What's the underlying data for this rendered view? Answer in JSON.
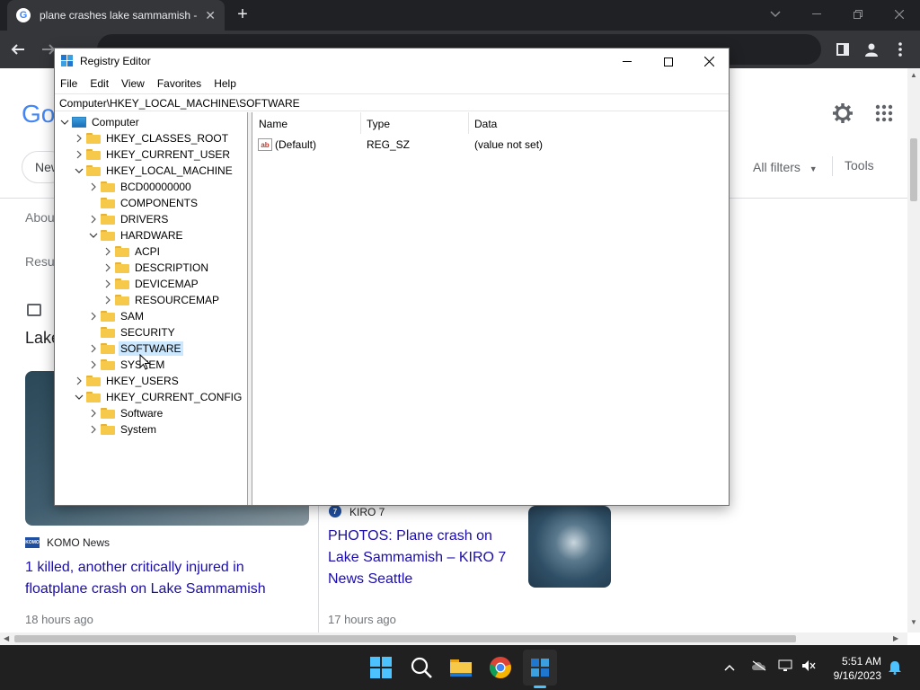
{
  "browser": {
    "tab_title": "plane crashes lake sammamish -",
    "tab_close": "✕",
    "new_tab": "+",
    "favicon": "G"
  },
  "google": {
    "logo_partial": "Go",
    "news_chip": "New",
    "all_filters": "All filters",
    "tools": "Tools",
    "about_partial": "Abou",
    "results_partial": "Resu",
    "lake_partial": "Lake",
    "article_1": {
      "source": "KOMO News",
      "source_logo": "KOMO",
      "headline": "1 killed, another critically injured in floatplane crash on Lake Sammamish",
      "time": "18 hours ago"
    },
    "article_2": {
      "source": "KIRO 7",
      "source_logo": "7",
      "headline": "PHOTOS: Plane crash on Lake Sammamish – KIRO 7 News Seattle",
      "time": "17 hours ago"
    }
  },
  "regedit": {
    "title": "Registry Editor",
    "menu": [
      "File",
      "Edit",
      "View",
      "Favorites",
      "Help"
    ],
    "address": "Computer\\HKEY_LOCAL_MACHINE\\SOFTWARE",
    "tree": [
      {
        "label": "Computer",
        "level": 0,
        "expander": "open",
        "icon": "computer"
      },
      {
        "label": "HKEY_CLASSES_ROOT",
        "level": 1,
        "expander": "closed",
        "icon": "folder"
      },
      {
        "label": "HKEY_CURRENT_USER",
        "level": 1,
        "expander": "closed",
        "icon": "folder"
      },
      {
        "label": "HKEY_LOCAL_MACHINE",
        "level": 1,
        "expander": "open",
        "icon": "folder"
      },
      {
        "label": "BCD00000000",
        "level": 2,
        "expander": "closed",
        "icon": "folder"
      },
      {
        "label": "COMPONENTS",
        "level": 2,
        "expander": "none",
        "icon": "folder"
      },
      {
        "label": "DRIVERS",
        "level": 2,
        "expander": "closed",
        "icon": "folder"
      },
      {
        "label": "HARDWARE",
        "level": 2,
        "expander": "open",
        "icon": "folder"
      },
      {
        "label": "ACPI",
        "level": 3,
        "expander": "closed",
        "icon": "folder"
      },
      {
        "label": "DESCRIPTION",
        "level": 3,
        "expander": "closed",
        "icon": "folder"
      },
      {
        "label": "DEVICEMAP",
        "level": 3,
        "expander": "closed",
        "icon": "folder"
      },
      {
        "label": "RESOURCEMAP",
        "level": 3,
        "expander": "closed",
        "icon": "folder"
      },
      {
        "label": "SAM",
        "level": 2,
        "expander": "closed",
        "icon": "folder"
      },
      {
        "label": "SECURITY",
        "level": 2,
        "expander": "none",
        "icon": "folder"
      },
      {
        "label": "SOFTWARE",
        "level": 2,
        "expander": "closed",
        "icon": "folder",
        "selected": true
      },
      {
        "label": "SYSTEM",
        "level": 2,
        "expander": "closed",
        "icon": "folder"
      },
      {
        "label": "HKEY_USERS",
        "level": 1,
        "expander": "closed",
        "icon": "folder"
      },
      {
        "label": "HKEY_CURRENT_CONFIG",
        "level": 1,
        "expander": "open",
        "icon": "folder"
      },
      {
        "label": "Software",
        "level": 2,
        "expander": "closed",
        "icon": "folder"
      },
      {
        "label": "System",
        "level": 2,
        "expander": "closed",
        "icon": "folder"
      }
    ],
    "columns": {
      "name": "Name",
      "type": "Type",
      "data": "Data"
    },
    "values": [
      {
        "name": "(Default)",
        "type": "REG_SZ",
        "data": "(value not set)",
        "icon_text": "ab"
      }
    ]
  },
  "taskbar": {
    "time": "5:51 AM",
    "date": "9/16/2023",
    "apps": [
      "windows-start",
      "search",
      "file-explorer",
      "chrome",
      "registry-editor"
    ]
  },
  "colors": {
    "accent": "#4cc2ff",
    "link": "#1a0dab",
    "selection": "#cce8ff",
    "folder": "#f6c94a"
  }
}
